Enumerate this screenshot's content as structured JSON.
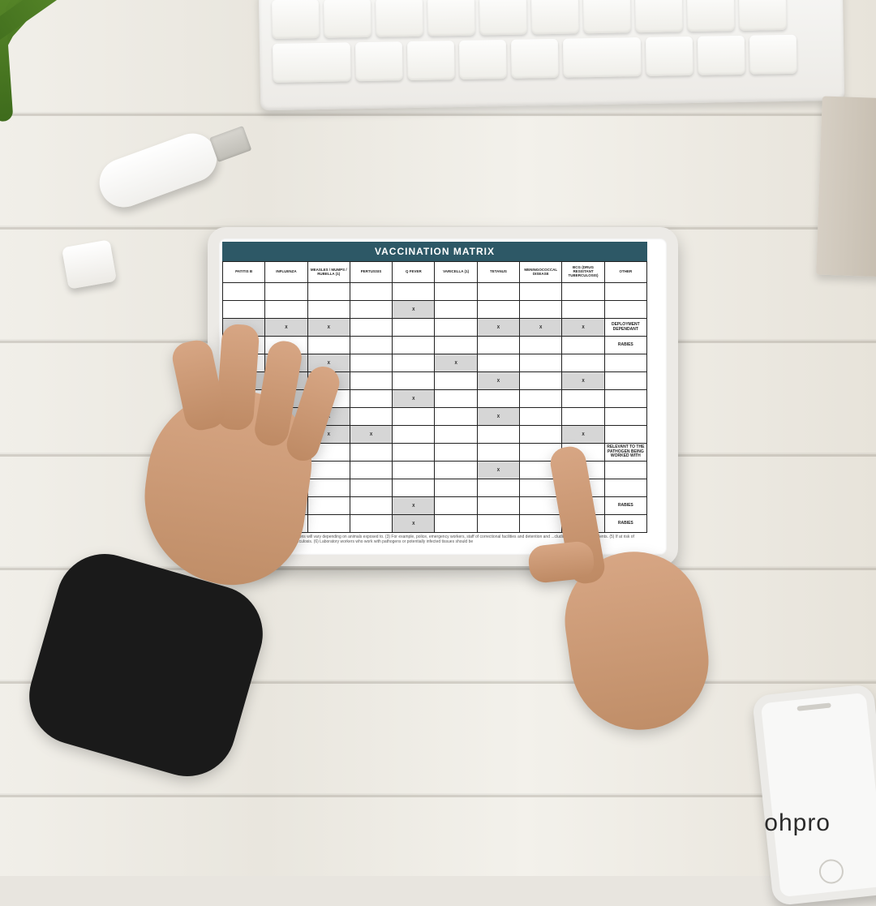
{
  "brand": "ohpro",
  "matrix": {
    "title": "VACCINATION MATRIX",
    "columns": [
      "PATITIS B",
      "INFLUENZA",
      "MEASLES / MUMPS / RUBELLA (1)",
      "PERTUSSIS",
      "Q FEVER",
      "VARICELLA (1)",
      "TETANUS",
      "MENINGOCOCCAL DISEASE",
      "BCG (DRUG RESISTANT TUBERCULOSIS)",
      "OTHER"
    ],
    "other_labels": {
      "deployment": "DEPLOYMENT DEPENDANT",
      "rabies": "RABIES",
      "relevant": "RELEVANT TO THE PATHOGEN BEING WORKED WITH"
    },
    "mark": "X",
    "rows": [
      {
        "cells": [
          0,
          0,
          0,
          0,
          0,
          0,
          0,
          0,
          0,
          0
        ],
        "other": ""
      },
      {
        "cells": [
          0,
          0,
          0,
          0,
          1,
          0,
          0,
          0,
          0,
          0
        ],
        "other": ""
      },
      {
        "cells": [
          1,
          1,
          1,
          0,
          0,
          0,
          1,
          1,
          1,
          0
        ],
        "other": "deployment"
      },
      {
        "cells": [
          0,
          0,
          0,
          0,
          0,
          0,
          0,
          0,
          0,
          0
        ],
        "other": "rabies"
      },
      {
        "cells": [
          0,
          1,
          1,
          0,
          0,
          1,
          0,
          0,
          0,
          0
        ],
        "other": ""
      },
      {
        "cells": [
          1,
          1,
          1,
          0,
          0,
          0,
          1,
          0,
          1,
          0
        ],
        "other": ""
      },
      {
        "cells": [
          0,
          1,
          0,
          0,
          1,
          0,
          0,
          0,
          0,
          0
        ],
        "other": ""
      },
      {
        "cells": [
          1,
          1,
          1,
          0,
          0,
          0,
          1,
          0,
          0,
          0
        ],
        "other": ""
      },
      {
        "cells": [
          1,
          0,
          1,
          1,
          0,
          0,
          0,
          0,
          1,
          0
        ],
        "other": ""
      },
      {
        "cells": [
          0,
          0,
          0,
          0,
          0,
          0,
          0,
          0,
          0,
          0
        ],
        "other": "relevant"
      },
      {
        "cells": [
          0,
          0,
          0,
          0,
          0,
          0,
          1,
          0,
          0,
          0
        ],
        "other": ""
      },
      {
        "cells": [
          0,
          1,
          0,
          0,
          0,
          0,
          0,
          0,
          0,
          0
        ],
        "other": ""
      },
      {
        "cells": [
          0,
          1,
          0,
          0,
          1,
          0,
          0,
          0,
          0,
          0
        ],
        "other": "rabies"
      },
      {
        "cells": [
          0,
          0,
          0,
          0,
          1,
          0,
          0,
          0,
          0,
          0
        ],
        "other": "rabies"
      }
    ],
    "footnote": "and students > 15 years. Actual vaccinations will vary depending on animals exposed to. (3) For example, police, emergency workers, staff of correctional facilities and detention and ...cluding trainees and students. (5) If at risk of exposure to drug resistant cases of tuberculosis. (6) Laboratory workers who work with pathogens or potentially infected tissues should be"
  }
}
